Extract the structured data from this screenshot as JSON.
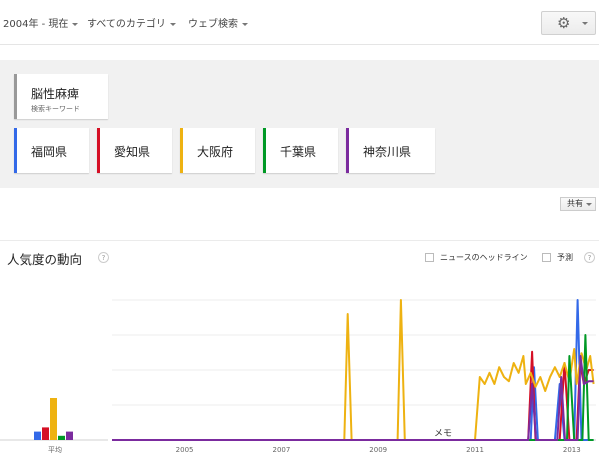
{
  "filters": {
    "time": "2004年 - 現在",
    "category": "すべてのカテゴリ",
    "search_type": "ウェブ検索"
  },
  "icons": {
    "settings": "gear-icon",
    "help": "help-icon",
    "dropdown": "chevron-down-icon"
  },
  "keyword_card": {
    "keyword": "脳性麻痺",
    "sublabel": "検索キーワード"
  },
  "terms": [
    {
      "label": "福岡県",
      "color": "#3369e8"
    },
    {
      "label": "愛知県",
      "color": "#d50f25"
    },
    {
      "label": "大阪府",
      "color": "#eeb211"
    },
    {
      "label": "千葉県",
      "color": "#009925"
    },
    {
      "label": "神奈川県",
      "color": "#7b2b9e"
    }
  ],
  "share_label": "共有",
  "section": {
    "title": "人気度の動向",
    "news_headlines_label": "ニュースのヘッドライン",
    "forecast_label": "予測"
  },
  "chart_data": {
    "type": "line",
    "x_tick_labels": [
      "2005",
      "2007",
      "2009",
      "2011",
      "2013"
    ],
    "average_label": "平均",
    "annotation": "メモ",
    "grid": true,
    "average_bars": [
      {
        "name": "福岡県",
        "value": 6
      },
      {
        "name": "愛知県",
        "value": 9
      },
      {
        "name": "大阪府",
        "value": 30
      },
      {
        "name": "千葉県",
        "value": 3
      },
      {
        "name": "神奈川県",
        "value": 6
      }
    ],
    "series": [
      {
        "color": "#3369e8",
        "points": [
          [
            2004.0,
            0
          ],
          [
            2012.65,
            0
          ],
          [
            2012.72,
            52
          ],
          [
            2012.8,
            0
          ],
          [
            2013.15,
            0
          ],
          [
            2013.25,
            40
          ],
          [
            2013.35,
            0
          ],
          [
            2013.55,
            0
          ],
          [
            2013.62,
            100
          ],
          [
            2013.7,
            0
          ],
          [
            2013.95,
            0
          ]
        ]
      },
      {
        "color": "#d50f25",
        "points": [
          [
            2004.0,
            0
          ],
          [
            2012.6,
            0
          ],
          [
            2012.68,
            63
          ],
          [
            2012.75,
            0
          ],
          [
            2013.25,
            0
          ],
          [
            2013.35,
            55
          ],
          [
            2013.45,
            0
          ],
          [
            2013.6,
            0
          ],
          [
            2013.67,
            55
          ],
          [
            2013.75,
            40
          ],
          [
            2013.85,
            50
          ],
          [
            2013.95,
            50
          ]
        ]
      },
      {
        "color": "#eeb211",
        "points": [
          [
            2004.0,
            0
          ],
          [
            2008.8,
            0
          ],
          [
            2008.87,
            90
          ],
          [
            2008.95,
            0
          ],
          [
            2009.9,
            0
          ],
          [
            2009.97,
            100
          ],
          [
            2010.05,
            0
          ],
          [
            2011.5,
            0
          ],
          [
            2011.6,
            45
          ],
          [
            2011.7,
            40
          ],
          [
            2011.8,
            48
          ],
          [
            2011.9,
            40
          ],
          [
            2012.0,
            52
          ],
          [
            2012.1,
            45
          ],
          [
            2012.2,
            42
          ],
          [
            2012.3,
            55
          ],
          [
            2012.4,
            48
          ],
          [
            2012.5,
            60
          ],
          [
            2012.55,
            40
          ],
          [
            2012.65,
            48
          ],
          [
            2012.75,
            38
          ],
          [
            2012.85,
            45
          ],
          [
            2012.95,
            35
          ],
          [
            2013.05,
            45
          ],
          [
            2013.15,
            52
          ],
          [
            2013.25,
            45
          ],
          [
            2013.35,
            55
          ],
          [
            2013.45,
            42
          ],
          [
            2013.55,
            65
          ],
          [
            2013.6,
            40
          ],
          [
            2013.7,
            62
          ],
          [
            2013.8,
            50
          ],
          [
            2013.88,
            60
          ],
          [
            2013.95,
            40
          ]
        ]
      },
      {
        "color": "#009925",
        "points": [
          [
            2004.0,
            0
          ],
          [
            2013.4,
            0
          ],
          [
            2013.45,
            60
          ],
          [
            2013.55,
            0
          ],
          [
            2013.72,
            0
          ],
          [
            2013.78,
            75
          ],
          [
            2013.85,
            0
          ],
          [
            2013.95,
            0
          ]
        ]
      },
      {
        "color": "#7b2b9e",
        "points": [
          [
            2004.0,
            0
          ],
          [
            2012.6,
            0
          ],
          [
            2012.68,
            40
          ],
          [
            2012.76,
            0
          ],
          [
            2013.2,
            0
          ],
          [
            2013.28,
            45
          ],
          [
            2013.36,
            0
          ],
          [
            2013.62,
            0
          ],
          [
            2013.68,
            60
          ],
          [
            2013.75,
            40
          ],
          [
            2013.85,
            42
          ],
          [
            2013.95,
            42
          ]
        ]
      }
    ]
  }
}
